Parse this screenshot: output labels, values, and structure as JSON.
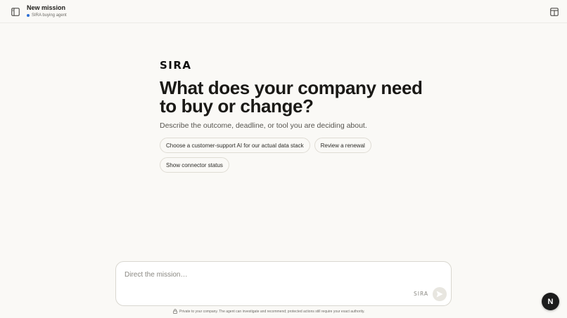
{
  "header": {
    "title": "New mission",
    "subtitle": "SIRA buying agent",
    "status_color": "#2d6fd6",
    "left_icon": "sidebar-toggle-icon",
    "right_icon": "panel-toggle-icon"
  },
  "hero": {
    "logo": "SIRA",
    "headline": "What does your company need to buy or change?",
    "subhead": "Describe the outcome, deadline, or tool you are deciding about.",
    "chips": [
      "Choose a customer-support AI for our actual data stack",
      "Review a renewal",
      "Show connector status"
    ]
  },
  "composer": {
    "placeholder": "Direct the mission…",
    "value": "",
    "brand": "SIRA",
    "send_icon": "send-icon"
  },
  "footer": {
    "note": "Private to your company. The agent can investigate and recommend; protected actions still require your exact authority.",
    "icon": "lock-icon"
  },
  "fab": {
    "label": "N"
  }
}
